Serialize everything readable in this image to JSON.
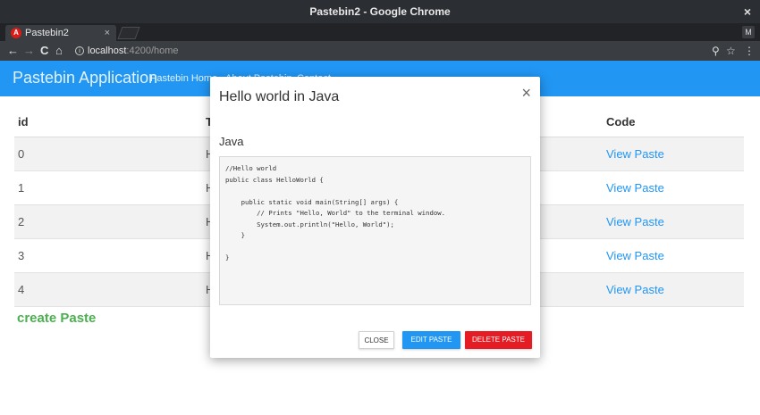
{
  "window": {
    "title": "Pastebin2 - Google Chrome",
    "close_glyph": "×"
  },
  "tab": {
    "favicon_letter": "A",
    "label": "Pastebin2",
    "close_glyph": "×",
    "profile": "M"
  },
  "toolbar": {
    "back": "←",
    "forward": "→",
    "reload": "C",
    "home": "⌂",
    "info": "i",
    "url_host": "localhost",
    "url_path": ":4200/home",
    "zoom": "⚲",
    "star": "☆",
    "menu": "⋮"
  },
  "nav": {
    "brand": "Pastebin Application",
    "links": [
      "Pastebin Home",
      "About Pastebin",
      "Contact"
    ]
  },
  "table": {
    "headers": {
      "id": "id",
      "title": "T",
      "code": "Code"
    },
    "rows": [
      {
        "id": "0",
        "title": "H",
        "code": "View Paste"
      },
      {
        "id": "1",
        "title": "H",
        "code": "View Paste"
      },
      {
        "id": "2",
        "title": "H",
        "code": "View Paste"
      },
      {
        "id": "3",
        "title": "H",
        "code": "View Paste"
      },
      {
        "id": "4",
        "title": "H",
        "code": "View Paste"
      }
    ]
  },
  "create_label": "create Paste",
  "modal": {
    "title": "Hello world in Java",
    "close_glyph": "×",
    "language": "Java",
    "code": "//Hello world\npublic class HelloWorld {\n\n    public static void main(String[] args) {\n        // Prints \"Hello, World\" to the terminal window.\n        System.out.println(\"Hello, World\");\n    }\n\n}",
    "buttons": {
      "close": "CLOSE",
      "edit": "EDIT PASTE",
      "delete": "DELETE PASTE"
    }
  }
}
